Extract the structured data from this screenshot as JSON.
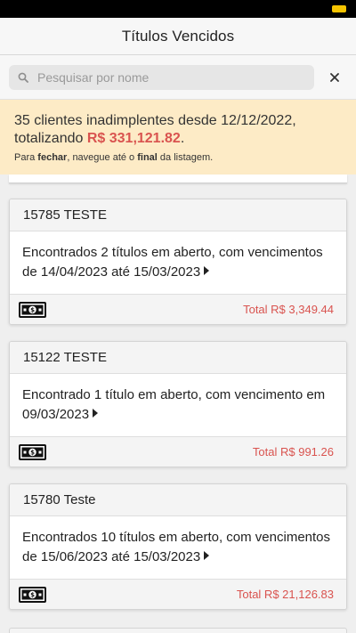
{
  "header": {
    "title": "Títulos Vencidos"
  },
  "search": {
    "placeholder": "Pesquisar por nome",
    "value": ""
  },
  "banner": {
    "line1": "35 clientes inadimplentes desde 12/12/2022,",
    "line2_prefix": "totalizando ",
    "line2_amount": "R$ 331,121.82",
    "line2_suffix": ".",
    "hint_prefix": "Para ",
    "hint_bold1": "fechar",
    "hint_middle": ", navegue até o ",
    "hint_bold2": "final",
    "hint_suffix": " da listagem."
  },
  "cards": [
    {
      "title": "15785 TESTE",
      "body": "Encontrados 2 títulos em aberto, com vencimentos de 14/04/2023 até 15/03/2023",
      "total": "Total R$ 3,349.44"
    },
    {
      "title": "15122 TESTE",
      "body": "Encontrado 1 título em aberto, com vencimento em 09/03/2023",
      "total": "Total R$ 991.26"
    },
    {
      "title": "15780 Teste",
      "body": "Encontrados 10 títulos em aberto, com vencimentos de 15/06/2023 até 15/03/2023",
      "total": "Total R$ 21,126.83"
    }
  ],
  "icons": {
    "search": "search-icon",
    "close": "close-icon",
    "money": "money-icon",
    "caret": "caret-right-icon"
  },
  "colors": {
    "accent_red": "#d9534f",
    "banner_bg": "#fdebc6",
    "battery": "#f5c400"
  }
}
